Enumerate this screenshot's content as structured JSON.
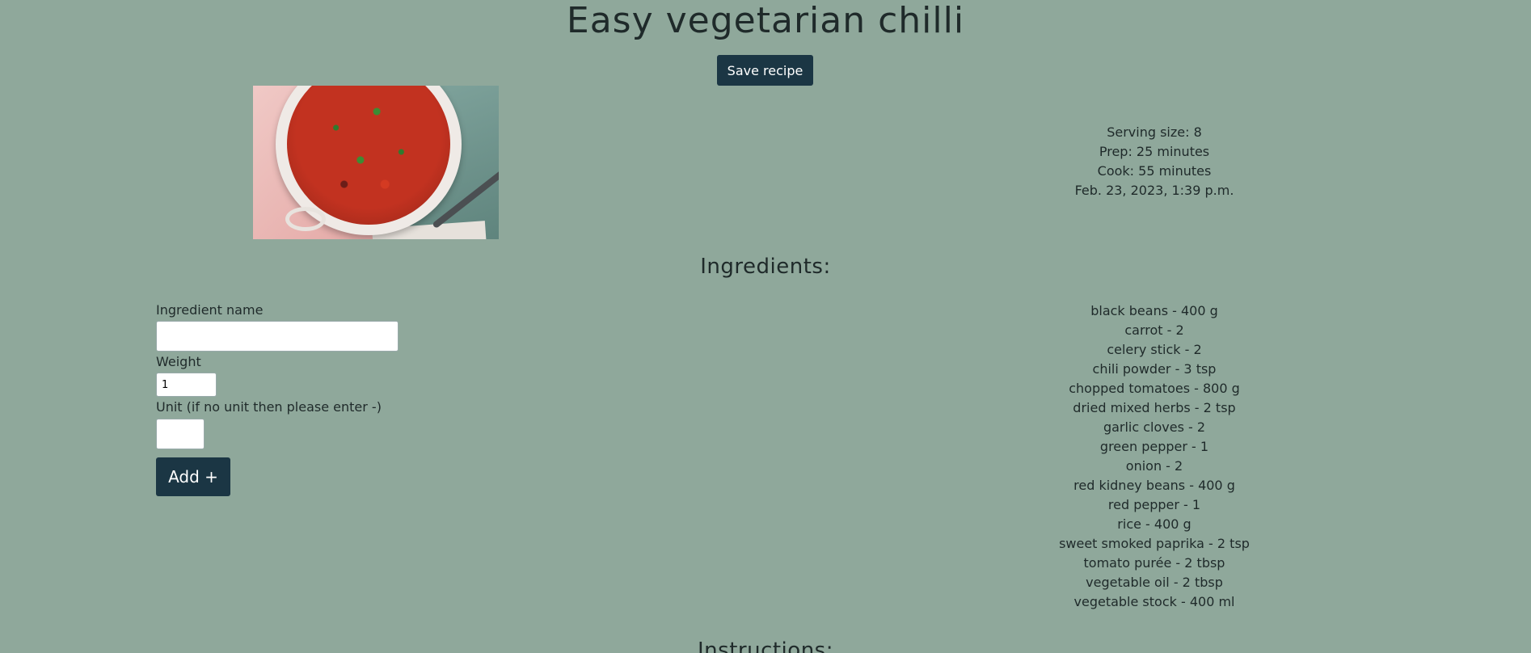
{
  "recipe": {
    "title": "Easy vegetarian chilli",
    "save_label": "Save recipe",
    "image": "recipe-photo",
    "serving_size": "Serving size: 8",
    "prep": "Prep: 25 minutes",
    "cook": "Cook: 55 minutes",
    "date": "Feb. 23, 2023, 1:39 p.m."
  },
  "ingredients": {
    "heading": "Ingredients:",
    "items": [
      "black beans - 400 g",
      "carrot - 2",
      "celery stick - 2",
      "chili powder - 3 tsp",
      "chopped tomatoes - 800 g",
      "dried mixed herbs - 2 tsp",
      "garlic cloves - 2",
      "green pepper - 1",
      "onion - 2",
      "red kidney beans - 400 g",
      "red pepper - 1",
      "rice - 400 g",
      "sweet smoked paprika - 2 tsp",
      "tomato purée - 2 tbsp",
      "vegetable oil - 2 tbsp",
      "vegetable stock - 400 ml"
    ]
  },
  "form": {
    "name_label": "Ingredient name",
    "name_value": "",
    "weight_label": "Weight",
    "weight_value": "1",
    "unit_label": "Unit (if no unit then please enter -)",
    "unit_value": "",
    "add_label": "Add +"
  },
  "instructions": {
    "heading": "Instructions:"
  },
  "colors": {
    "background": "#8fa89b",
    "button": "#1b3644",
    "button_text": "#ffffff"
  }
}
